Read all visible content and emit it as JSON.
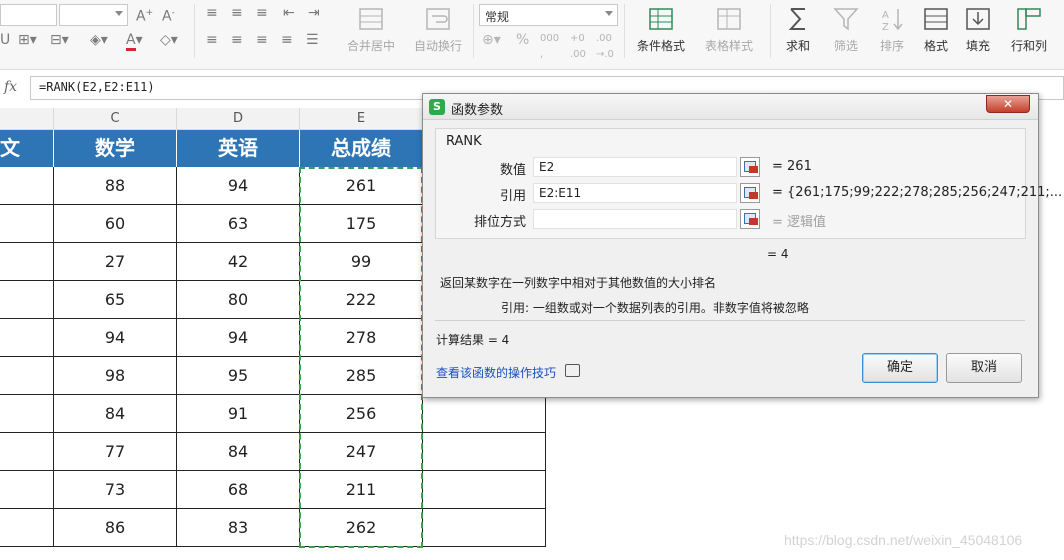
{
  "ribbon": {
    "number_format": "常规",
    "buttons": {
      "merge_center": "合并居中",
      "auto_wrap": "自动换行",
      "conditional_format": "条件格式",
      "table_style": "表格样式",
      "sum": "求和",
      "filter": "筛选",
      "sort": "排序",
      "format": "格式",
      "fill": "填充",
      "rows_cols": "行和列"
    }
  },
  "formula_bar": {
    "fx": "fx",
    "formula": "=RANK(E2,E2:E11)"
  },
  "sheet": {
    "columns": [
      "C",
      "D",
      "E"
    ],
    "headers": [
      "文",
      "数学",
      "英语",
      "总成绩"
    ],
    "rows": [
      {
        "C": "88",
        "D": "94",
        "E": "261"
      },
      {
        "C": "60",
        "D": "63",
        "E": "175"
      },
      {
        "C": "27",
        "D": "42",
        "E": "99"
      },
      {
        "C": "65",
        "D": "80",
        "E": "222"
      },
      {
        "C": "94",
        "D": "94",
        "E": "278"
      },
      {
        "C": "98",
        "D": "95",
        "E": "285"
      },
      {
        "C": "84",
        "D": "91",
        "E": "256"
      },
      {
        "C": "77",
        "D": "84",
        "E": "247"
      },
      {
        "C": "73",
        "D": "68",
        "E": "211"
      },
      {
        "C": "86",
        "D": "83",
        "E": "262"
      }
    ]
  },
  "dialog": {
    "title": "函数参数",
    "close": "✕",
    "function_name": "RANK",
    "params": [
      {
        "label": "数值",
        "value": "E2",
        "result": "=  261"
      },
      {
        "label": "引用",
        "value": "E2:E11",
        "result": "=  {261;175;99;222;278;285;256;247;211;..."
      },
      {
        "label": "排位方式",
        "value": "",
        "result": "=  逻辑值"
      }
    ],
    "formula_result": "=  4",
    "description": "返回某数字在一列数字中相对于其他数值的大小排名",
    "param_help": "引用:   一组数或对一个数据列表的引用。非数字值将被忽略",
    "calc_result": "计算结果  =  4",
    "help_link": "查看该函数的操作技巧",
    "ok": "确定",
    "cancel": "取消"
  },
  "watermark": "https://blog.csdn.net/weixin_45048106"
}
